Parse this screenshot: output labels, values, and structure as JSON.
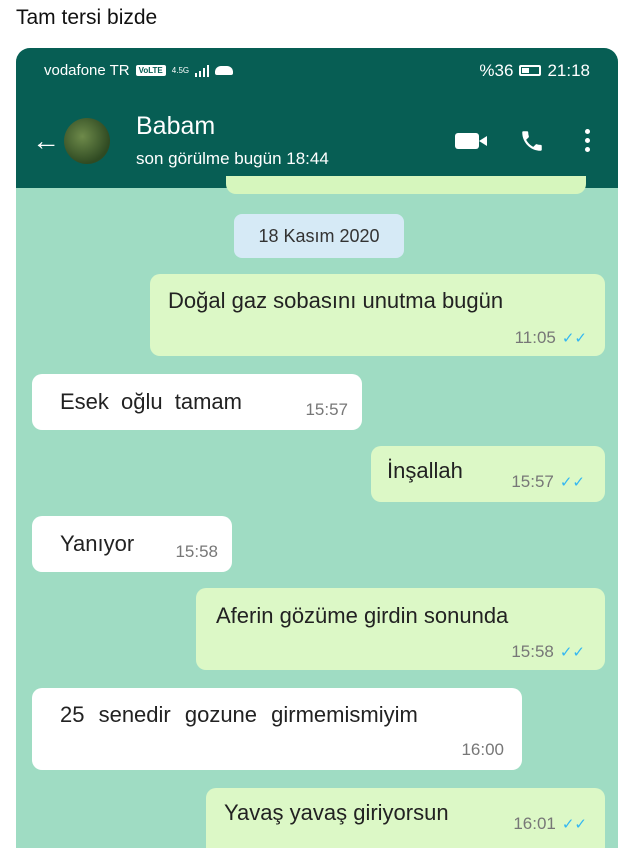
{
  "caption": "Tam tersi bizde",
  "status_bar": {
    "carrier": "vodafone TR",
    "volte": "VoLTE",
    "network": "4.5G",
    "battery": "%36",
    "time": "21:18",
    "battery_level": 0.36
  },
  "header": {
    "contact_name": "Babam",
    "last_seen": "son görülme bugün 18:44"
  },
  "chat": {
    "date_chip": "18 Kasım 2020",
    "messages": [
      {
        "dir": "out",
        "text": "Doğal gaz sobasını unutma bugün",
        "time": "11:05",
        "read": true
      },
      {
        "dir": "in",
        "text": "Esek oğlu tamam",
        "time": "15:57"
      },
      {
        "dir": "out",
        "text": "İnşallah",
        "time": "15:57",
        "read": true
      },
      {
        "dir": "in",
        "text": "Yanıyor",
        "time": "15:58"
      },
      {
        "dir": "out",
        "text": "Aferin gözüme girdin sonunda",
        "time": "15:58",
        "read": true
      },
      {
        "dir": "in",
        "text": "25 senedir gozune girmemismiyim",
        "time": "16:00"
      },
      {
        "dir": "out",
        "text": "Yavaş yavaş giriyorsun",
        "time": "16:01",
        "read": true
      }
    ]
  }
}
